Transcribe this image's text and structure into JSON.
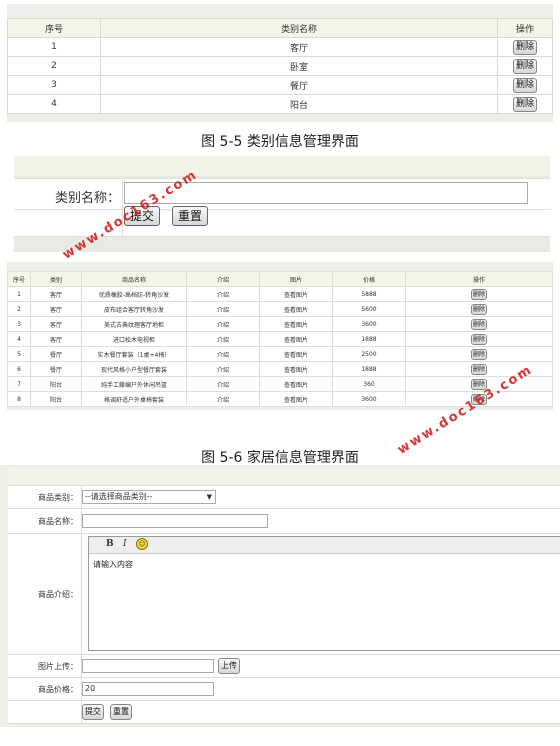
{
  "category_table": {
    "headers": [
      "序号",
      "类别名称",
      "操作"
    ],
    "rows": [
      {
        "no": "1",
        "name": "客厅",
        "action": "删除"
      },
      {
        "no": "2",
        "name": "卧室",
        "action": "删除"
      },
      {
        "no": "3",
        "name": "餐厅",
        "action": "删除"
      },
      {
        "no": "4",
        "name": "阳台",
        "action": "删除"
      }
    ]
  },
  "caption_1": "图 5-5 类别信息管理界面",
  "category_form": {
    "label": "类别名称：",
    "submit": "提交",
    "reset": "重置"
  },
  "product_table": {
    "headers": [
      "序号",
      "类别",
      "商品名称",
      "介绍",
      "图片",
      "价格",
      "操作"
    ],
    "rows": [
      {
        "no": "1",
        "cat": "客厅",
        "name": "优质橡胶-高档纺-转角沙发",
        "intro": "介绍",
        "img": "查看图片",
        "price": "5888",
        "action": "删除"
      },
      {
        "no": "2",
        "cat": "客厅",
        "name": "皮布组合客厅转角沙发",
        "intro": "介绍",
        "img": "查看图片",
        "price": "5600",
        "action": "删除"
      },
      {
        "no": "3",
        "cat": "客厅",
        "name": "美式古典纹理客厅地柜",
        "intro": "介绍",
        "img": "查看图片",
        "price": "3600",
        "action": "删除"
      },
      {
        "no": "4",
        "cat": "客厅",
        "name": "进口松木电视柜",
        "intro": "介绍",
        "img": "查看图片",
        "price": "1888",
        "action": "删除"
      },
      {
        "no": "5",
        "cat": "餐厅",
        "name": "实木餐厅套装（1桌+4椅）",
        "intro": "介绍",
        "img": "查看图片",
        "price": "2500",
        "action": "删除"
      },
      {
        "no": "6",
        "cat": "餐厅",
        "name": "现代风格小户型餐厅套装",
        "intro": "介绍",
        "img": "查看图片",
        "price": "1888",
        "action": "删除"
      },
      {
        "no": "7",
        "cat": "阳台",
        "name": "纯手工藤编户外休闲吊篮",
        "intro": "介绍",
        "img": "查看图片",
        "price": "360",
        "action": "删除"
      },
      {
        "no": "8",
        "cat": "阳台",
        "name": "格调舒适户外桌椅套装",
        "intro": "介绍",
        "img": "查看图片",
        "price": "3600",
        "action": "删除"
      }
    ]
  },
  "caption_2": "图 5-6 家居信息管理界面",
  "product_form": {
    "category_label": "商品类别：",
    "category_select": "--请选择商品类别--",
    "name_label": "商品名称：",
    "intro_label": "商品介绍：",
    "editor_bold": "B",
    "editor_italic": "I",
    "editor_placeholder": "请输入内容",
    "upload_label": "图片上传：",
    "upload_button": "上传",
    "price_label": "商品价格：",
    "price_value": "20",
    "submit": "提交",
    "reset": "重置"
  },
  "watermark": "www.doc163.com"
}
